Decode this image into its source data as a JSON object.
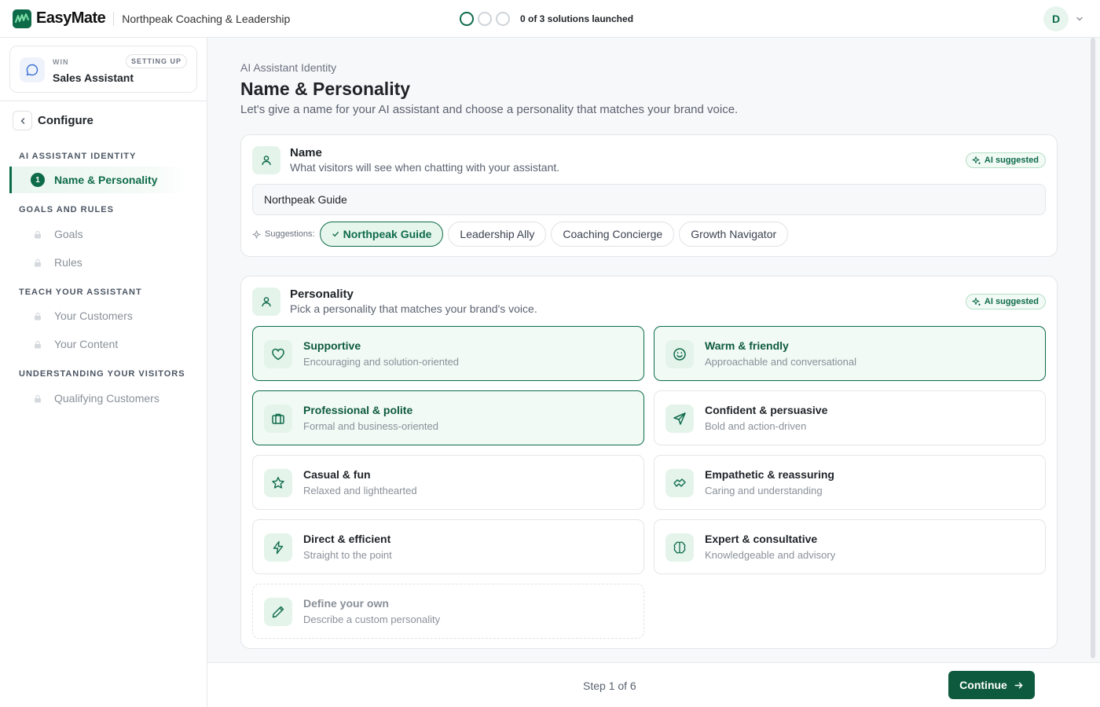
{
  "app": {
    "name": "EasyMate",
    "org": "Northpeak Coaching & Leadership"
  },
  "progress": {
    "text": "0 of 3 solutions launched",
    "total": 3,
    "launched": 0
  },
  "user": {
    "initial": "D"
  },
  "solution": {
    "kicker": "WIN",
    "name": "Sales Assistant",
    "status": "SETTING UP"
  },
  "sidebar": {
    "title": "Configure",
    "sections": [
      {
        "label": "AI ASSISTANT IDENTITY",
        "items": [
          {
            "num": "1",
            "label": "Name & Personality"
          }
        ]
      },
      {
        "label": "GOALS AND RULES",
        "items": [
          {
            "label": "Goals"
          },
          {
            "label": "Rules"
          }
        ]
      },
      {
        "label": "TEACH YOUR ASSISTANT",
        "items": [
          {
            "label": "Your Customers"
          },
          {
            "label": "Your Content"
          }
        ]
      },
      {
        "label": "UNDERSTANDING YOUR VISITORS",
        "items": [
          {
            "label": "Qualifying Customers"
          }
        ]
      }
    ]
  },
  "main": {
    "breadcrumb": "AI Assistant Identity",
    "title": "Name & Personality",
    "subtitle": "Let's give a name for your AI assistant and choose a personality that matches your brand voice.",
    "name_panel": {
      "title": "Name",
      "subtitle": "What visitors will see when chatting with your assistant.",
      "badge": "AI suggested",
      "value": "Northpeak Guide",
      "suggestions_label": "Suggestions:",
      "suggestions": [
        "Northpeak Guide",
        "Leadership Ally",
        "Coaching Concierge",
        "Growth Navigator"
      ]
    },
    "personality_panel": {
      "title": "Personality",
      "subtitle": "Pick a personality that matches your brand's voice.",
      "badge": "AI suggested",
      "options": [
        {
          "title": "Supportive",
          "desc": "Encouraging and solution-oriented",
          "icon": "heart-icon",
          "selected": true
        },
        {
          "title": "Warm & friendly",
          "desc": "Approachable and conversational",
          "icon": "smile-icon",
          "selected": true
        },
        {
          "title": "Professional & polite",
          "desc": "Formal and business-oriented",
          "icon": "briefcase-icon",
          "selected": true
        },
        {
          "title": "Confident & persuasive",
          "desc": "Bold and action-driven",
          "icon": "send-icon",
          "selected": false
        },
        {
          "title": "Casual & fun",
          "desc": "Relaxed and lighthearted",
          "icon": "star-icon",
          "selected": false
        },
        {
          "title": "Empathetic & reassuring",
          "desc": "Caring and understanding",
          "icon": "handshake-icon",
          "selected": false
        },
        {
          "title": "Direct & efficient",
          "desc": "Straight to the point",
          "icon": "bolt-icon",
          "selected": false
        },
        {
          "title": "Expert & consultative",
          "desc": "Knowledgeable and advisory",
          "icon": "brain-icon",
          "selected": false
        },
        {
          "title": "Define your own",
          "desc": "Describe a custom personality",
          "icon": "pencil-icon",
          "selected": false
        }
      ]
    }
  },
  "footer": {
    "step": "Step 1 of 6",
    "continue_label": "Continue"
  },
  "colors": {
    "brand": "#0e6b4a",
    "brand_dark": "#0e5a3f",
    "selected_bg": "#f1faf5",
    "icon_bg": "#e4f4ea"
  }
}
